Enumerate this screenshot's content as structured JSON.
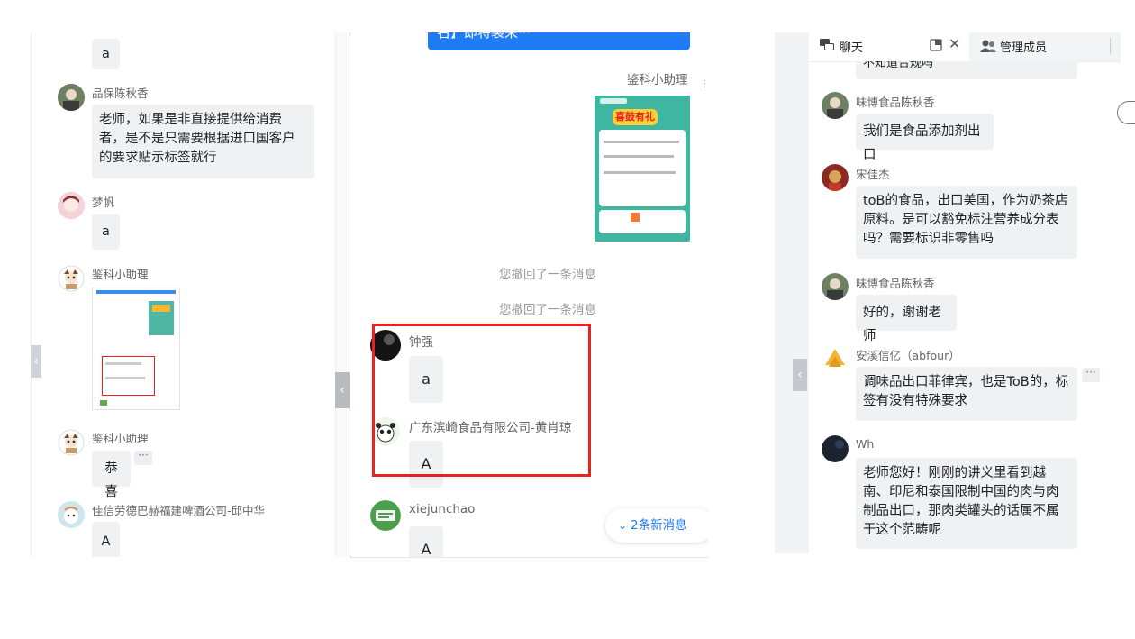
{
  "left": {
    "messages": [
      {
        "name": "",
        "text": "a"
      },
      {
        "name": "品保陈秋香",
        "text": "老师，如果是非直接提供给消费者，是不是只需要根据进口国客户的要求贴示标签就行"
      },
      {
        "name": "梦帆",
        "text": "a"
      },
      {
        "name": "鉴科小助理",
        "text": ""
      },
      {
        "name": "鉴科小助理",
        "text": "恭喜"
      },
      {
        "name": "佳信劳德巴赫福建啤酒公司-邱中华",
        "text": "A"
      }
    ],
    "more_label": "···"
  },
  "middle": {
    "top_bubble": "名】即将袭来···",
    "assistant_name": "鉴科小助理",
    "poster_title": "喜鼓有礼",
    "recall_1": "您撤回了一条消息",
    "recall_2": "您撤回了一条消息",
    "messages": [
      {
        "name": "钟强",
        "text": "a"
      },
      {
        "name": "广东滨崎食品有限公司-黄肖琼",
        "text": "A"
      },
      {
        "name": "xiejunchao",
        "text": "A"
      }
    ],
    "new_messages_label": "2条新消息",
    "highlight_color": "#e8231f"
  },
  "right": {
    "tabs": {
      "chat": "聊天",
      "members": "管理成员"
    },
    "top_partial_text": "不知道合规吗",
    "messages": [
      {
        "name": "味博食品陈秋香",
        "text": "我们是食品添加剂出口"
      },
      {
        "name": "宋佳杰",
        "text": "toB的食品，出口美国，作为奶茶店原料。是可以豁免标注营养成分表吗？需要标识非零售吗"
      },
      {
        "name": "味博食品陈秋香",
        "text": "好的，谢谢老师"
      },
      {
        "name": "安溪信亿（abfour）",
        "text": "调味品出口菲律宾，也是ToB的，标签有没有特殊要求"
      },
      {
        "name": "Wh",
        "text": "老师您好！刚刚的讲义里看到越南、印尼和泰国限制中国的肉与肉制品出口，那肉类罐头的话属不属于这个范畴呢"
      }
    ],
    "more_label": "···"
  },
  "colors": {
    "bubble_bg": "#f0f1f3",
    "accent_blue": "#1f7cf5",
    "recall_gray": "#999999"
  }
}
